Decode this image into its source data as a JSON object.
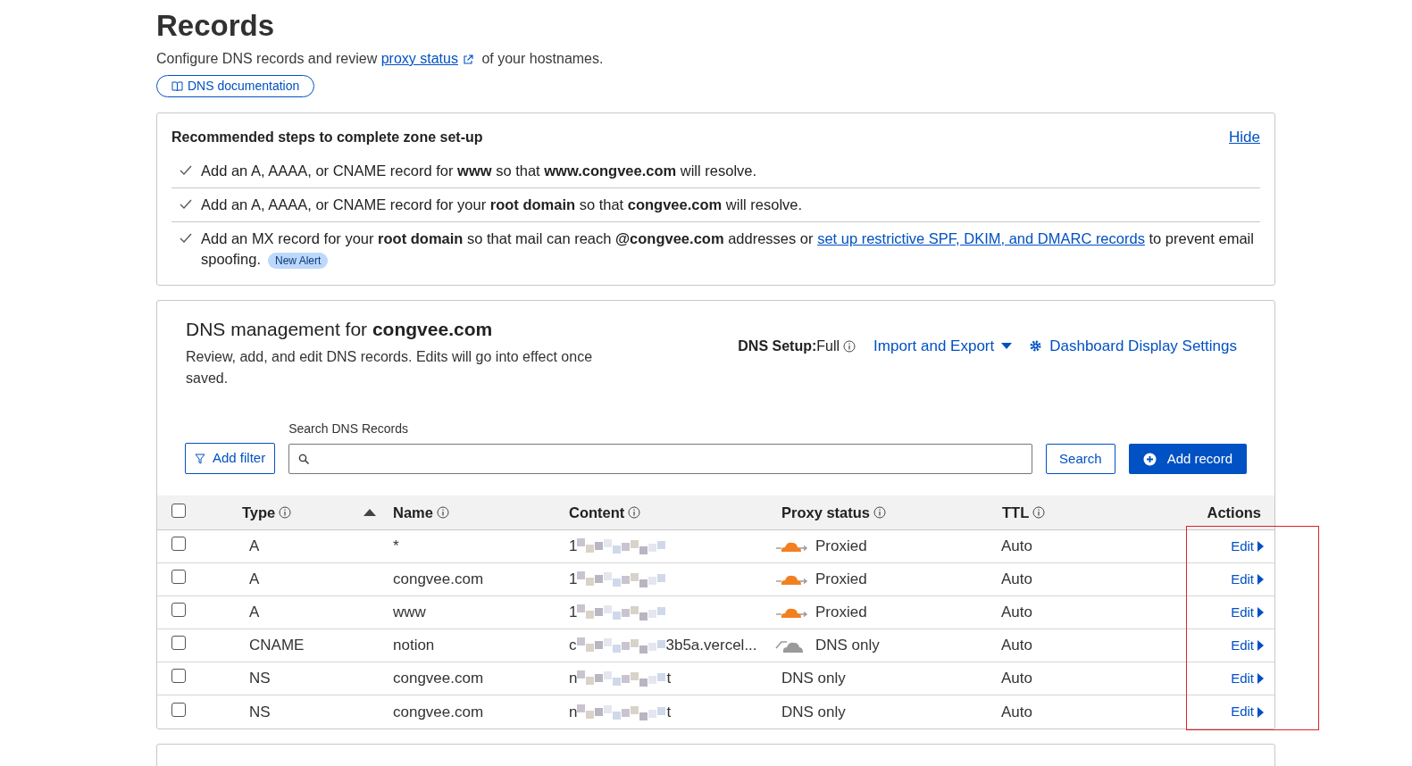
{
  "page": {
    "title": "Records",
    "description": {
      "before": "Configure DNS records and review ",
      "link": "proxy status",
      "after": " of your hostnames."
    },
    "doc_button": "DNS documentation"
  },
  "setup_card": {
    "title": "Recommended steps to complete zone set-up",
    "hide": "Hide",
    "steps": [
      {
        "text": "Add an A, AAAA, or CNAME record for **www** so that **www.congvee.com** will resolve.",
        "done": true
      },
      {
        "text": "Add an A, AAAA, or CNAME record for your **root domain** so that **congvee.com** will resolve.",
        "done": true
      },
      {
        "text": "Add an MX record for your **root domain** so that mail can reach **@congvee.com** addresses or ",
        "link": "set up restrictive SPF, DKIM, and DMARC records",
        "after": " to prevent email spoofing.",
        "badge": "New Alert",
        "done": true
      }
    ]
  },
  "management": {
    "title": "DNS management for **congvee.com**",
    "subtitle": "Review, add, and edit DNS records. Edits will go into effect once saved.",
    "setup_label": "DNS Setup:",
    "setup_value": "Full",
    "import_export": "Import and Export",
    "display_settings": "Dashboard Display Settings",
    "add_filter": "Add filter",
    "search_label": "Search DNS Records",
    "search_button": "Search",
    "add_record": "Add record"
  },
  "table": {
    "select_all": {
      "checked": false
    },
    "columns": [
      {
        "label": "Type",
        "info": true,
        "sorted": true
      },
      {
        "label": "Name",
        "info": true,
        "sorted": false
      },
      {
        "label": "Content",
        "info": true,
        "sorted": false
      },
      {
        "label": "Proxy status",
        "info": true,
        "sorted": false
      },
      {
        "label": "TTL",
        "info": true,
        "sorted": false
      },
      {
        "label": "Actions",
        "info": false,
        "sorted": false
      }
    ],
    "rows": [
      {
        "checked": false,
        "type": "A",
        "name": "*",
        "content_start": "1",
        "content_end": "",
        "proxy": {
          "kind": "proxied",
          "label": "Proxied"
        },
        "ttl": "Auto",
        "action": "Edit"
      },
      {
        "checked": false,
        "type": "A",
        "name": "congvee.com",
        "content_start": "1",
        "content_end": "",
        "proxy": {
          "kind": "proxied",
          "label": "Proxied"
        },
        "ttl": "Auto",
        "action": "Edit"
      },
      {
        "checked": false,
        "type": "A",
        "name": "www",
        "content_start": "1",
        "content_end": "",
        "proxy": {
          "kind": "proxied",
          "label": "Proxied"
        },
        "ttl": "Auto",
        "action": "Edit"
      },
      {
        "checked": false,
        "type": "CNAME",
        "name": "notion",
        "content_start": "c",
        "content_end": "3b5a.vercel...",
        "proxy": {
          "kind": "dns_only",
          "label": "DNS only"
        },
        "ttl": "Auto",
        "action": "Edit"
      },
      {
        "checked": false,
        "type": "NS",
        "name": "congvee.com",
        "content_start": "n",
        "content_end": "t",
        "proxy": {
          "kind": "plain",
          "label": "DNS only"
        },
        "ttl": "Auto",
        "action": "Edit"
      },
      {
        "checked": false,
        "type": "NS",
        "name": "congvee.com",
        "content_start": "n",
        "content_end": "t",
        "proxy": {
          "kind": "plain",
          "label": "DNS only"
        },
        "ttl": "Auto",
        "action": "Edit"
      }
    ]
  },
  "annotation": {
    "kind": "frame",
    "color": "#e0202a"
  }
}
